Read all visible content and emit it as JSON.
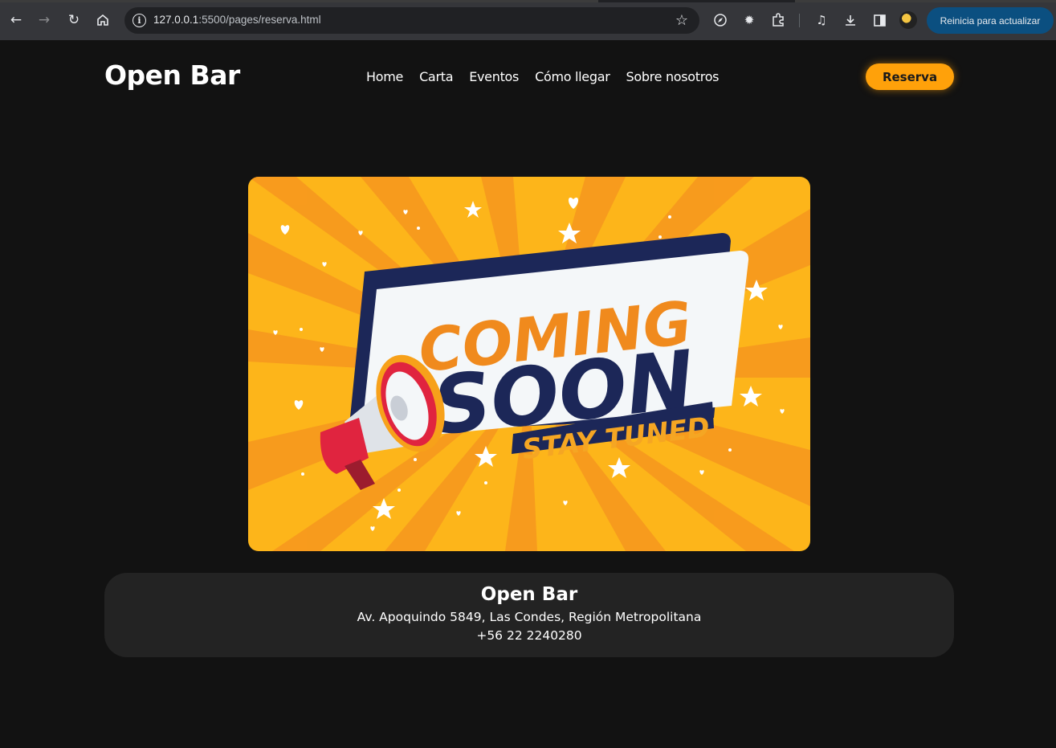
{
  "browser": {
    "url_host": "127.0.0.1",
    "url_path": ":5500/pages/reserva.html",
    "update_label": "Reinicia para actualizar"
  },
  "header": {
    "brand": "Open Bar",
    "nav": [
      "Home",
      "Carta",
      "Eventos",
      "Cómo llegar",
      "Sobre nosotros"
    ],
    "cta": "Reserva"
  },
  "banner": {
    "line1": "COMING",
    "line2": "SOON",
    "line3": "STAY TUNED",
    "colors": {
      "background": "#fdb51a",
      "ray": "#f5931f",
      "navy": "#1c2758",
      "orange_text": "#f08a1d",
      "card": "#f4f7f9",
      "megaphone": "#e0243f"
    }
  },
  "footer": {
    "name": "Open Bar",
    "address": "Av. Apoquindo 5849, Las Condes, Región Metropolitana",
    "phone": "+56 22 2240280"
  }
}
